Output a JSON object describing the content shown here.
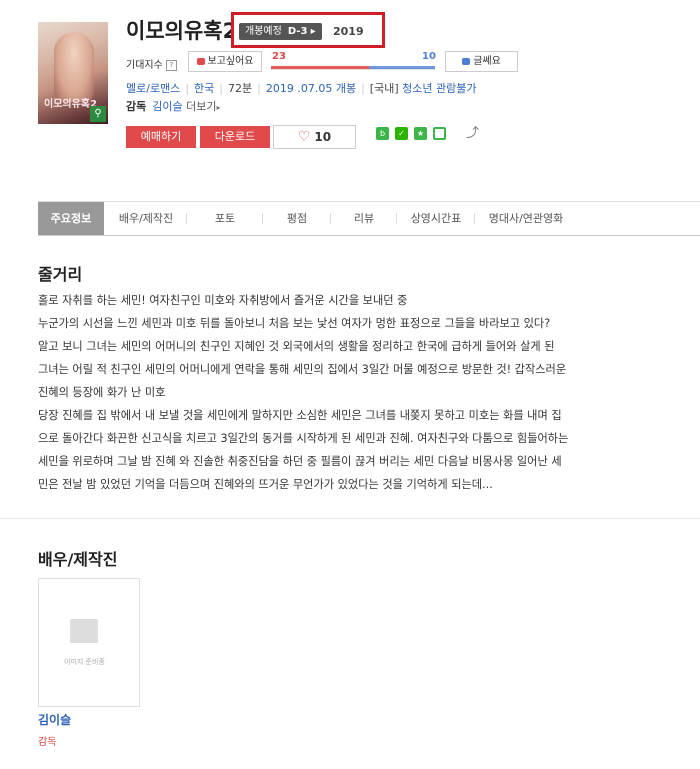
{
  "movie": {
    "title": "이모의유혹2",
    "poster_title": "이모의유혹2",
    "open_badge": "개봉예정",
    "dday": "D-3",
    "year": "2019"
  },
  "expect": {
    "label": "기대지수",
    "question_mark": "?",
    "want_button": "보고싶어요",
    "dislike_button": "글쎄요",
    "want_count": "23",
    "dislike_count": "10",
    "want_ratio": 0.6
  },
  "meta": {
    "genre": "멜로/로맨스",
    "country": "한국",
    "runtime": "72분",
    "release": "2019 .07.05 개봉",
    "rating_region": "[국내]",
    "rating": "청소년 관람불가"
  },
  "director": {
    "label": "감독",
    "name": "김이슬",
    "more": "더보기"
  },
  "actions": {
    "reserve": "예매하기",
    "download": "다운로드",
    "likes": "10"
  },
  "share": {
    "icons": [
      "blog-icon",
      "naver-icon",
      "bookmark-icon",
      "kakao-icon",
      "share-icon"
    ]
  },
  "tabs": [
    {
      "label": "주요정보"
    },
    {
      "label": "배우/제작진"
    },
    {
      "label": "포토"
    },
    {
      "label": "평점"
    },
    {
      "label": "리뷰"
    },
    {
      "label": "상영시간표"
    },
    {
      "label": "명대사/연관영화"
    }
  ],
  "synopsis": {
    "heading": "줄거리",
    "lines": [
      "홀로 자취를 하는 세민! 여자친구인 미호와 자취방에서 즐거운 시간을 보내던 중",
      " 누군가의 시선을 느낀 세민과 미호 뒤를 돌아보니 처음 보는 낯선 여자가 멍한 표정으로 그들을 바라보고 있다?",
      " 알고 보니 그녀는 세민의 어머니의 친구인 지혜인 것 외국에서의 생활을 정리하고 한국에 급하게 들어와 살게 된",
      "그녀는 어릴 적 친구인 세민의 어머니에게 연락을 통해 세민의 집에서 3일간 머물 예정으로 방문한 것! 갑작스러운",
      "진혜의 등장에 화가 난 미호",
      " 당장 진혜를 집 밖에서 내 보낼 것을 세민에게 말하지만 소심한 세민은 그녀를 내쫒지 못하고 미호는 화를 내며 집",
      "으로 돌아간다 화끈한 신고식을 치르고 3일간의 동거를 시작하게 된 세민과 진혜. 여자친구와 다툼으로 힘들어하는",
      "세민을 위로하며 그날 밤 진혜 와 진솔한 취중진담을 하던 중 필름이 끊겨 버리는 세민 다음날 비몽사몽 일어난 세",
      "민은 전날 밤 있었던 기억을 더듬으며 진혜와의 뜨거운 무언가가 있었다는 것을 기억하게 되는데..."
    ]
  },
  "cast": {
    "heading": "배우/제작진",
    "no_image": "이미지 준비중",
    "members": [
      {
        "name": "김이슬",
        "role": "감독"
      }
    ]
  },
  "colors": {
    "accent_red": "#e04a4a",
    "link_blue": "#2d63b7",
    "highlight_box": "#d01f27"
  }
}
